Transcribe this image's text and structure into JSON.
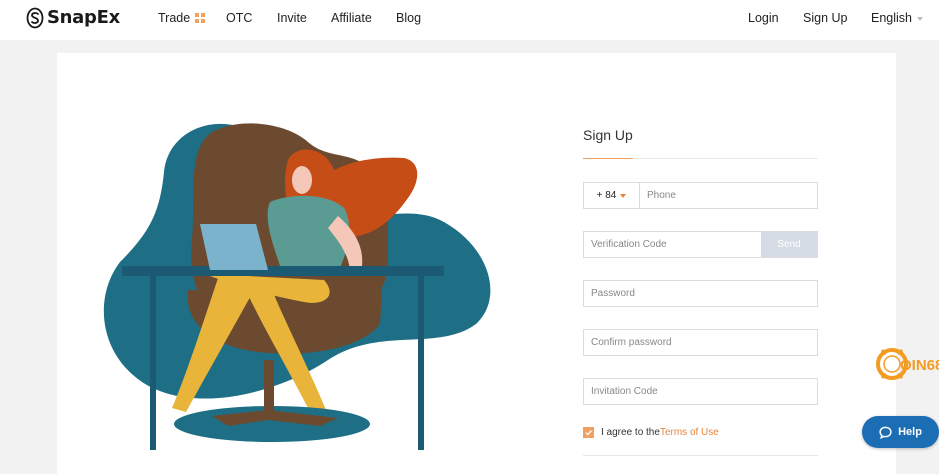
{
  "header": {
    "brand": "SnapEx",
    "nav": {
      "trade": "Trade",
      "otc": "OTC",
      "invite": "Invite",
      "affiliate": "Affiliate",
      "blog": "Blog"
    },
    "login": "Login",
    "signup": "Sign Up",
    "language": "English"
  },
  "form": {
    "title": "Sign Up",
    "country_code": "+ 84",
    "phone_placeholder": "Phone",
    "verification_placeholder": "Verification Code",
    "send_label": "Send",
    "password_placeholder": "Password",
    "confirm_placeholder": "Confirm password",
    "invitation_placeholder": "Invitation Code",
    "agree_text": "I agree to the",
    "terms_label": "Terms of Use",
    "agree_checked": true
  },
  "widgets": {
    "coin_badge": "OIN68",
    "help_label": "Help"
  },
  "colors": {
    "accent": "#e8843a",
    "send_button": "#d5dce6",
    "help_button": "#1b6db4",
    "illustration_teal": "#1e6f86",
    "illustration_brown": "#6b4a30"
  }
}
